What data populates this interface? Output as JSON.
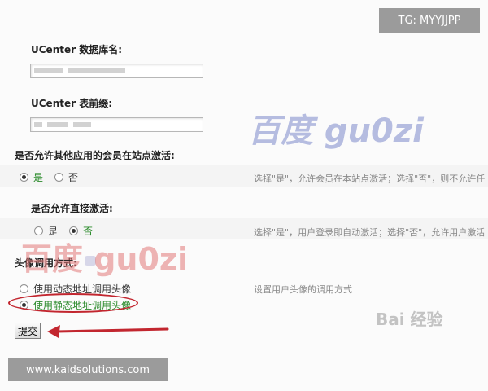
{
  "form": {
    "ucenter_db": {
      "label": "UCenter 数据库名:"
    },
    "ucenter_prefix": {
      "label": "UCenter 表前缀:"
    },
    "allow_activate_other": {
      "label": "是否允许其他应用的会员在站点激活:",
      "options": [
        "是",
        "否"
      ],
      "selected": "是",
      "desc": "选择\"是\"，允许会员在本站点激活；选择\"否\"，则不允许任"
    },
    "allow_direct_activate": {
      "label": "是否允许直接激活:",
      "options": [
        "是",
        "否"
      ],
      "selected": "否",
      "desc": "选择\"是\"，用户登录即自动激活；选择\"否\"，允许用户激活"
    },
    "avatar_mode": {
      "label": "头像调用方式:",
      "options": [
        "使用动态地址调用头像",
        "使用静态地址调用头像"
      ],
      "selected": "使用静态地址调用头像",
      "desc": "设置用户头像的调用方式"
    },
    "submit_label": "提交"
  },
  "overlays": {
    "top_tag": "TG: MYYJJPP",
    "bottom_tag": "www.kaidsolutions.com",
    "watermark_blue": "百度 gu0zi",
    "watermark_red": "百度 gu0zi",
    "watermark_baidu": "Bai 经验"
  },
  "colors": {
    "annotation_red": "#c2262f",
    "selected_green": "#2a8a2a"
  }
}
